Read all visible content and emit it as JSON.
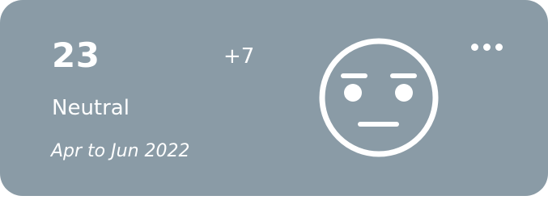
{
  "card": {
    "value": "23",
    "delta": "+7",
    "sentiment": "Neutral",
    "period": "Apr to Jun 2022",
    "icon": "neutral-face-icon",
    "menu_icon": "more-options-icon",
    "background_color": "#8a9ba6",
    "text_color": "#ffffff"
  }
}
